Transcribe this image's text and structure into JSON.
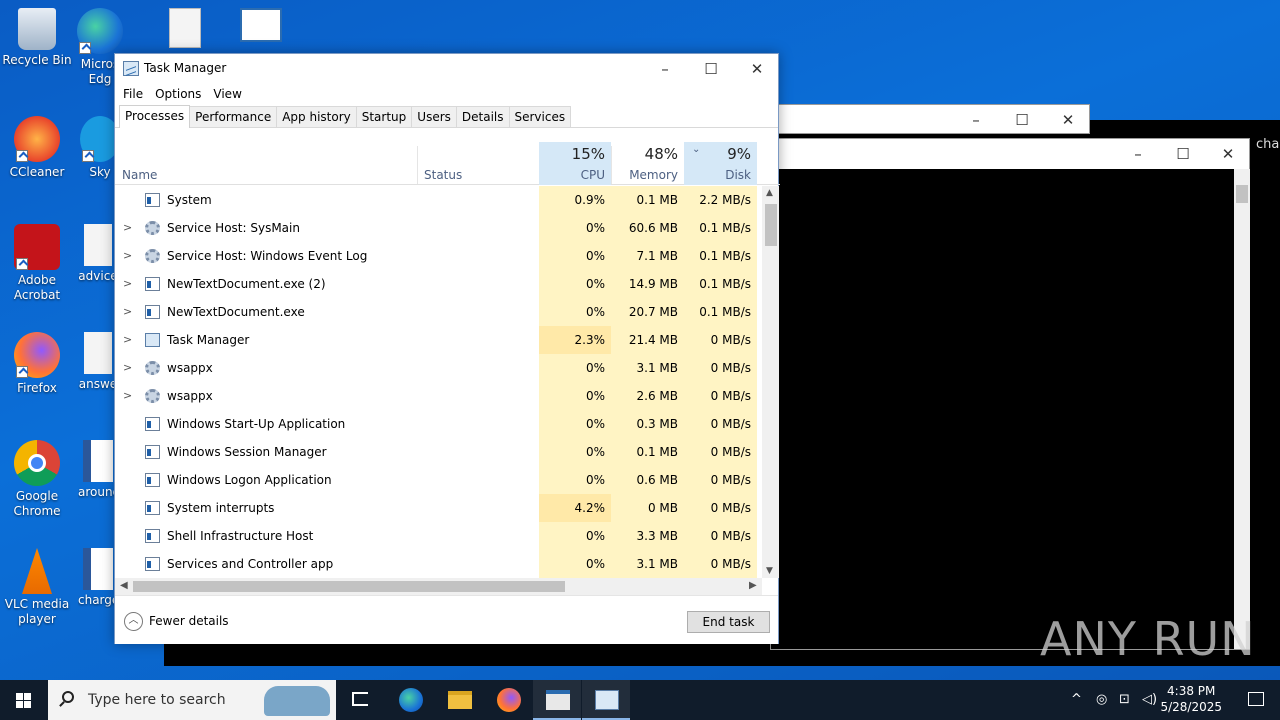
{
  "desktop": {
    "icons": [
      {
        "label": "Recycle Bin"
      },
      {
        "label": "Micros Edg"
      },
      {
        "label": "CCleaner"
      },
      {
        "label": "Sky"
      },
      {
        "label": "Adobe Acrobat"
      },
      {
        "label": "advice"
      },
      {
        "label": "Firefox"
      },
      {
        "label": "answe"
      },
      {
        "label": "Google Chrome"
      },
      {
        "label": "around"
      },
      {
        "label": "VLC media player"
      },
      {
        "label": "charge"
      }
    ],
    "partial_text": "cha",
    "watermark": "ANY RUN"
  },
  "task_manager": {
    "title": "Task Manager",
    "menu": [
      "File",
      "Options",
      "View"
    ],
    "tabs": [
      "Processes",
      "Performance",
      "App history",
      "Startup",
      "Users",
      "Details",
      "Services"
    ],
    "active_tab": "Processes",
    "columns": {
      "name": "Name",
      "status": "Status",
      "cpu": {
        "pct": "15%",
        "label": "CPU"
      },
      "memory": {
        "pct": "48%",
        "label": "Memory"
      },
      "disk": {
        "pct": "9%",
        "label": "Disk"
      }
    },
    "processes": [
      {
        "name": "System",
        "expandable": false,
        "icon": "window-icon",
        "cpu": "0.9%",
        "memory": "0.1 MB",
        "disk": "2.2 MB/s"
      },
      {
        "name": "Service Host: SysMain",
        "expandable": true,
        "icon": "gear-icon",
        "cpu": "0%",
        "memory": "60.6 MB",
        "disk": "0.1 MB/s"
      },
      {
        "name": "Service Host: Windows Event Log",
        "expandable": true,
        "icon": "gear-icon",
        "cpu": "0%",
        "memory": "7.1 MB",
        "disk": "0.1 MB/s"
      },
      {
        "name": "NewTextDocument.exe (2)",
        "expandable": true,
        "icon": "window-icon",
        "cpu": "0%",
        "memory": "14.9 MB",
        "disk": "0.1 MB/s"
      },
      {
        "name": "NewTextDocument.exe",
        "expandable": true,
        "icon": "window-icon",
        "cpu": "0%",
        "memory": "20.7 MB",
        "disk": "0.1 MB/s"
      },
      {
        "name": "Task Manager",
        "expandable": true,
        "icon": "task-manager-icon",
        "cpu": "2.3%",
        "memory": "21.4 MB",
        "disk": "0 MB/s"
      },
      {
        "name": "wsappx",
        "expandable": true,
        "icon": "gear-icon",
        "cpu": "0%",
        "memory": "3.1 MB",
        "disk": "0 MB/s"
      },
      {
        "name": "wsappx",
        "expandable": true,
        "icon": "gear-icon",
        "cpu": "0%",
        "memory": "2.6 MB",
        "disk": "0 MB/s"
      },
      {
        "name": "Windows Start-Up Application",
        "expandable": false,
        "icon": "window-icon",
        "cpu": "0%",
        "memory": "0.3 MB",
        "disk": "0 MB/s"
      },
      {
        "name": "Windows Session Manager",
        "expandable": false,
        "icon": "window-icon",
        "cpu": "0%",
        "memory": "0.1 MB",
        "disk": "0 MB/s"
      },
      {
        "name": "Windows Logon Application",
        "expandable": false,
        "icon": "window-icon",
        "cpu": "0%",
        "memory": "0.6 MB",
        "disk": "0 MB/s"
      },
      {
        "name": "System interrupts",
        "expandable": false,
        "icon": "window-icon",
        "cpu": "4.2%",
        "memory": "0 MB",
        "disk": "0 MB/s"
      },
      {
        "name": "Shell Infrastructure Host",
        "expandable": false,
        "icon": "window-icon",
        "cpu": "0%",
        "memory": "3.3 MB",
        "disk": "0 MB/s"
      },
      {
        "name": "Services and Controller app",
        "expandable": false,
        "icon": "window-icon",
        "cpu": "0%",
        "memory": "3.1 MB",
        "disk": "0 MB/s"
      }
    ],
    "footer": {
      "fewer_details": "Fewer details",
      "end_task": "End task"
    }
  },
  "taskbar": {
    "search_placeholder": "Type here to search",
    "time": "4:38 PM",
    "date": "5/28/2025"
  },
  "colors": {
    "desktop_bg": "#0b6fd8",
    "taskbar_bg": "#101c2b",
    "cell_highlight": "#fff4c4",
    "cell_highlight_strong": "#ffe9a8"
  }
}
